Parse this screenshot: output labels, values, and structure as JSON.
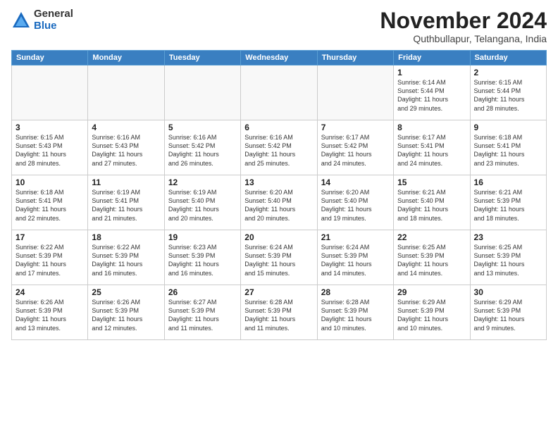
{
  "logo": {
    "general": "General",
    "blue": "Blue"
  },
  "title": "November 2024",
  "location": "Quthbullapur, Telangana, India",
  "headers": [
    "Sunday",
    "Monday",
    "Tuesday",
    "Wednesday",
    "Thursday",
    "Friday",
    "Saturday"
  ],
  "weeks": [
    [
      {
        "day": "",
        "info": ""
      },
      {
        "day": "",
        "info": ""
      },
      {
        "day": "",
        "info": ""
      },
      {
        "day": "",
        "info": ""
      },
      {
        "day": "",
        "info": ""
      },
      {
        "day": "1",
        "info": "Sunrise: 6:14 AM\nSunset: 5:44 PM\nDaylight: 11 hours\nand 29 minutes."
      },
      {
        "day": "2",
        "info": "Sunrise: 6:15 AM\nSunset: 5:44 PM\nDaylight: 11 hours\nand 28 minutes."
      }
    ],
    [
      {
        "day": "3",
        "info": "Sunrise: 6:15 AM\nSunset: 5:43 PM\nDaylight: 11 hours\nand 28 minutes."
      },
      {
        "day": "4",
        "info": "Sunrise: 6:16 AM\nSunset: 5:43 PM\nDaylight: 11 hours\nand 27 minutes."
      },
      {
        "day": "5",
        "info": "Sunrise: 6:16 AM\nSunset: 5:42 PM\nDaylight: 11 hours\nand 26 minutes."
      },
      {
        "day": "6",
        "info": "Sunrise: 6:16 AM\nSunset: 5:42 PM\nDaylight: 11 hours\nand 25 minutes."
      },
      {
        "day": "7",
        "info": "Sunrise: 6:17 AM\nSunset: 5:42 PM\nDaylight: 11 hours\nand 24 minutes."
      },
      {
        "day": "8",
        "info": "Sunrise: 6:17 AM\nSunset: 5:41 PM\nDaylight: 11 hours\nand 24 minutes."
      },
      {
        "day": "9",
        "info": "Sunrise: 6:18 AM\nSunset: 5:41 PM\nDaylight: 11 hours\nand 23 minutes."
      }
    ],
    [
      {
        "day": "10",
        "info": "Sunrise: 6:18 AM\nSunset: 5:41 PM\nDaylight: 11 hours\nand 22 minutes."
      },
      {
        "day": "11",
        "info": "Sunrise: 6:19 AM\nSunset: 5:41 PM\nDaylight: 11 hours\nand 21 minutes."
      },
      {
        "day": "12",
        "info": "Sunrise: 6:19 AM\nSunset: 5:40 PM\nDaylight: 11 hours\nand 20 minutes."
      },
      {
        "day": "13",
        "info": "Sunrise: 6:20 AM\nSunset: 5:40 PM\nDaylight: 11 hours\nand 20 minutes."
      },
      {
        "day": "14",
        "info": "Sunrise: 6:20 AM\nSunset: 5:40 PM\nDaylight: 11 hours\nand 19 minutes."
      },
      {
        "day": "15",
        "info": "Sunrise: 6:21 AM\nSunset: 5:40 PM\nDaylight: 11 hours\nand 18 minutes."
      },
      {
        "day": "16",
        "info": "Sunrise: 6:21 AM\nSunset: 5:39 PM\nDaylight: 11 hours\nand 18 minutes."
      }
    ],
    [
      {
        "day": "17",
        "info": "Sunrise: 6:22 AM\nSunset: 5:39 PM\nDaylight: 11 hours\nand 17 minutes."
      },
      {
        "day": "18",
        "info": "Sunrise: 6:22 AM\nSunset: 5:39 PM\nDaylight: 11 hours\nand 16 minutes."
      },
      {
        "day": "19",
        "info": "Sunrise: 6:23 AM\nSunset: 5:39 PM\nDaylight: 11 hours\nand 16 minutes."
      },
      {
        "day": "20",
        "info": "Sunrise: 6:24 AM\nSunset: 5:39 PM\nDaylight: 11 hours\nand 15 minutes."
      },
      {
        "day": "21",
        "info": "Sunrise: 6:24 AM\nSunset: 5:39 PM\nDaylight: 11 hours\nand 14 minutes."
      },
      {
        "day": "22",
        "info": "Sunrise: 6:25 AM\nSunset: 5:39 PM\nDaylight: 11 hours\nand 14 minutes."
      },
      {
        "day": "23",
        "info": "Sunrise: 6:25 AM\nSunset: 5:39 PM\nDaylight: 11 hours\nand 13 minutes."
      }
    ],
    [
      {
        "day": "24",
        "info": "Sunrise: 6:26 AM\nSunset: 5:39 PM\nDaylight: 11 hours\nand 13 minutes."
      },
      {
        "day": "25",
        "info": "Sunrise: 6:26 AM\nSunset: 5:39 PM\nDaylight: 11 hours\nand 12 minutes."
      },
      {
        "day": "26",
        "info": "Sunrise: 6:27 AM\nSunset: 5:39 PM\nDaylight: 11 hours\nand 11 minutes."
      },
      {
        "day": "27",
        "info": "Sunrise: 6:28 AM\nSunset: 5:39 PM\nDaylight: 11 hours\nand 11 minutes."
      },
      {
        "day": "28",
        "info": "Sunrise: 6:28 AM\nSunset: 5:39 PM\nDaylight: 11 hours\nand 10 minutes."
      },
      {
        "day": "29",
        "info": "Sunrise: 6:29 AM\nSunset: 5:39 PM\nDaylight: 11 hours\nand 10 minutes."
      },
      {
        "day": "30",
        "info": "Sunrise: 6:29 AM\nSunset: 5:39 PM\nDaylight: 11 hours\nand 9 minutes."
      }
    ]
  ]
}
